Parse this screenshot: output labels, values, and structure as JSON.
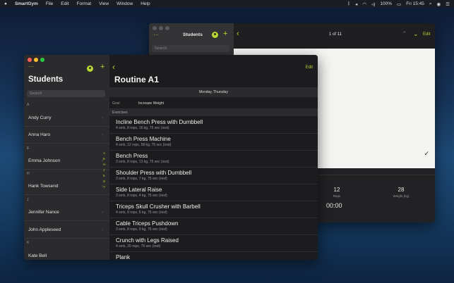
{
  "menubar": {
    "app": "SmartGym",
    "items": [
      "File",
      "Edit",
      "Format",
      "View",
      "Window",
      "Help"
    ],
    "battery": "100%",
    "clock": "Fri 15:45"
  },
  "back": {
    "title": "Students",
    "search_placeholder": "Search",
    "counter": "1 of 11",
    "edit": "Edit",
    "stats": [
      {
        "value": "12",
        "label": "Reps"
      },
      {
        "value": "28",
        "label": "Weight (kg)"
      }
    ],
    "timer": "00:00"
  },
  "front": {
    "sidebar": {
      "title": "Students",
      "search_placeholder": "Search",
      "sections": [
        {
          "letter": "A",
          "students": [
            "Andy Curry",
            "Anna Haro"
          ]
        },
        {
          "letter": "E",
          "students": [
            "Emma Johnson"
          ]
        },
        {
          "letter": "H",
          "students": [
            "Hank Towsend"
          ]
        },
        {
          "letter": "J",
          "students": [
            "Jennifer Nance",
            "John Appleseed"
          ]
        },
        {
          "letter": "K",
          "students": [
            "Kate Bell"
          ]
        }
      ],
      "index": [
        "A",
        "E",
        "H",
        "J",
        "K",
        "S",
        "Y"
      ]
    },
    "routine": {
      "title": "Routine A1",
      "edit": "Edit",
      "days": "Monday, Thursday",
      "goal_label": "Goal",
      "goal_value": "Increase Weight",
      "exercises_label": "Exercises",
      "exercises": [
        {
          "name": "Incline Bench Press with Dumbbell",
          "detail": "4 sets, 8 reps, 16 kg, 75 sec (rest)"
        },
        {
          "name": "Bench Press Machine",
          "detail": "4 sets, 12 reps, 58 kg, 75 sec (rest)"
        },
        {
          "name": "Bench Press",
          "detail": "3 sets, 8 reps, 13 kg, 75 sec (rest)"
        },
        {
          "name": "Shoulder Press with Dumbbell",
          "detail": "3 sets, 8 reps, 7 kg, 75 sec (rest)"
        },
        {
          "name": "Side Lateral Raise",
          "detail": "3 sets, 8 reps, 4 kg, 75 sec (rest)"
        },
        {
          "name": "Triceps Skull Crusher with Barbell",
          "detail": "4 sets, 8 reps, 6 kg, 75 sec (rest)"
        },
        {
          "name": "Cable Triceps Pushdown",
          "detail": "3 sets, 8 reps, 9 kg, 75 sec (rest)"
        },
        {
          "name": "Crunch with Legs Raised",
          "detail": "4 sets, 20 reps, 75 sec (rest)"
        },
        {
          "name": "Plank",
          "detail": ""
        }
      ]
    }
  }
}
